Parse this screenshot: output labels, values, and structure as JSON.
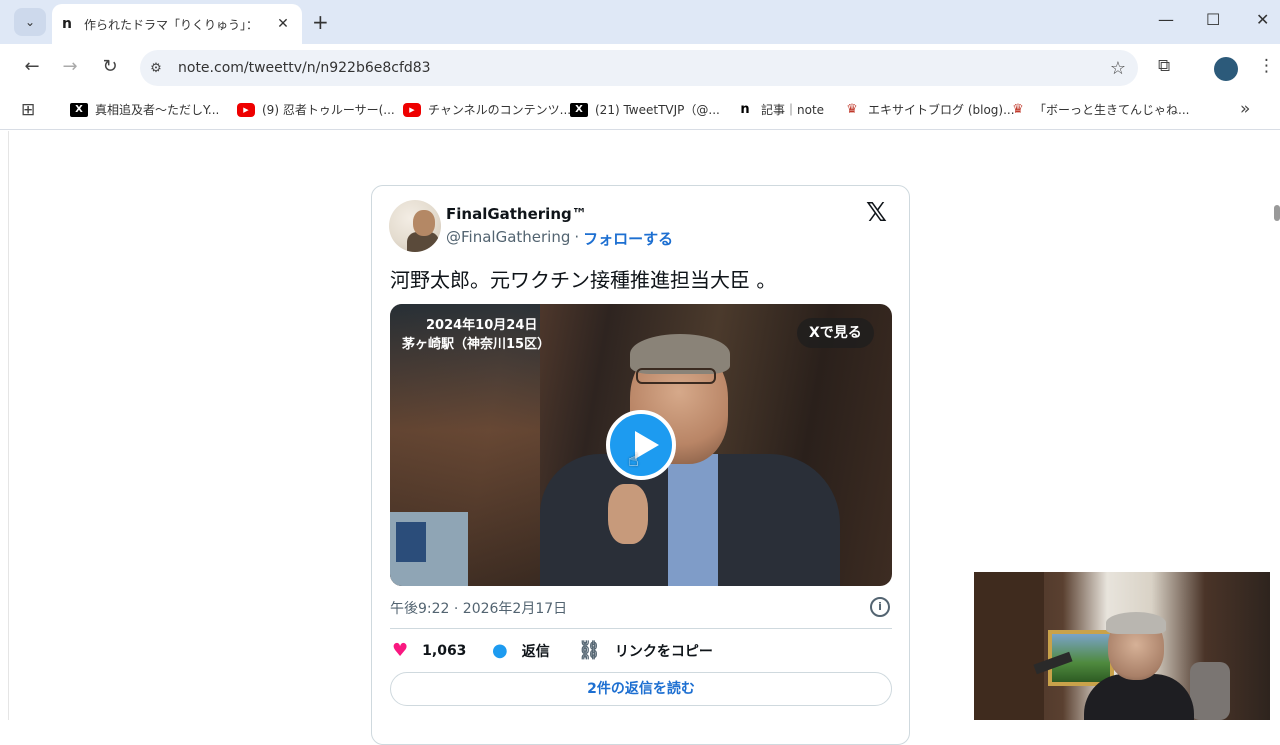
{
  "browser": {
    "tab": {
      "favicon": "n",
      "title": "作られたドラマ「りくりゅう」：",
      "close_glyph": "✕"
    },
    "newtab_glyph": "+",
    "window_controls": {
      "minimize": "—",
      "maximize": "☐",
      "close": "✕"
    },
    "url": "note.com/tweettv/n/n922b6e8cfd83",
    "bookmarks": [
      {
        "icon": "x-icon",
        "label": "真相追及者〜ただしY..."
      },
      {
        "icon": "youtube-icon",
        "label": "(9) 忍者トゥルーサー(..."
      },
      {
        "icon": "youtube-icon",
        "label": "チャンネルのコンテンツ..."
      },
      {
        "icon": "x-icon",
        "label": "(21) TweetTVJP（@..."
      },
      {
        "icon": "note-icon",
        "label": "記事｜note"
      },
      {
        "icon": "excite-icon",
        "label": "エキサイトブログ (blog)..."
      },
      {
        "icon": "excite-icon",
        "label": "「ボーっと生きてんじゃね..."
      }
    ]
  },
  "tweet": {
    "name": "FinalGathering™",
    "handle": "@FinalGathering",
    "separator": "·",
    "follow_label": "フォローする",
    "x_logo": "𝕏",
    "text": "河野太郎。元ワクチン接種推進担当大臣 。",
    "media": {
      "date_caption": "2024年10月24日",
      "place_caption": "茅ヶ崎駅（神奈川15区）",
      "view_on_x_label": "Xで見る"
    },
    "timestamp": "午後9:22 · 2026年2月17日",
    "info_glyph": "i",
    "likes": "1,063",
    "reply_label": "返信",
    "copy_link_label": "リンクをコピー",
    "read_replies_label": "2件の返信を読む"
  }
}
